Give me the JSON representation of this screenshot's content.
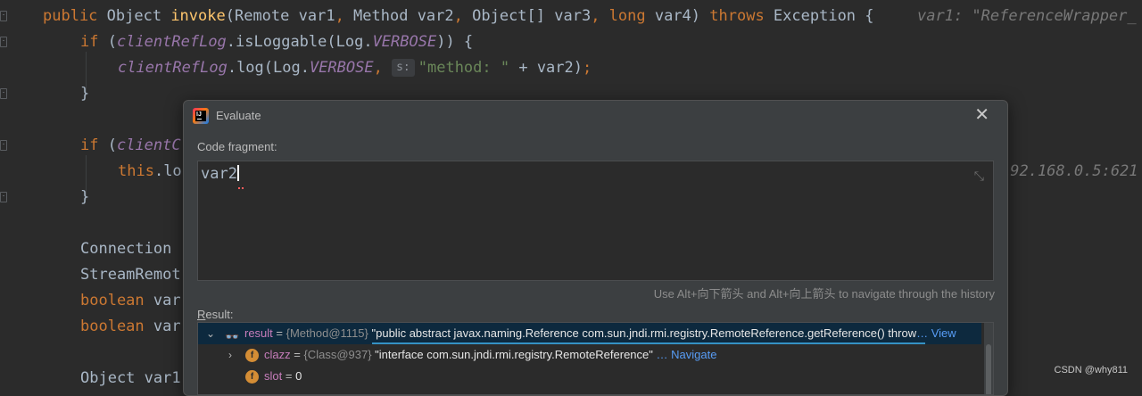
{
  "editor": {
    "lines": [
      {
        "parts": [
          [
            "kw",
            "public "
          ],
          [
            "plain",
            "Object "
          ],
          [
            "fn",
            "invoke"
          ],
          [
            "plain",
            "(Remote var1"
          ],
          [
            "kw",
            ", "
          ],
          [
            "plain",
            "Method var2"
          ],
          [
            "kw",
            ", "
          ],
          [
            "plain",
            "Object[] var3"
          ],
          [
            "kw",
            ", long "
          ],
          [
            "plain",
            "var4) "
          ],
          [
            "kw",
            "throws "
          ],
          [
            "plain",
            "Exception {"
          ]
        ]
      },
      {
        "parts": [
          [
            "kw",
            "if "
          ],
          [
            "plain",
            "("
          ],
          [
            "fld",
            "clientRefLog"
          ],
          [
            "plain",
            ".isLoggable(Log."
          ],
          [
            "fld",
            "VERBOSE"
          ],
          [
            "plain",
            ")) {"
          ]
        ]
      },
      {
        "parts": [
          [
            "fld",
            "clientRefLog"
          ],
          [
            "plain",
            ".log(Log."
          ],
          [
            "fld",
            "VERBOSE"
          ],
          [
            "kw",
            ", "
          ],
          [
            "hint",
            "s:"
          ],
          [
            "str",
            "\"method: \""
          ],
          [
            "plain",
            " + var2)"
          ],
          [
            "kw",
            ";"
          ]
        ]
      },
      {
        "parts": [
          [
            "plain",
            "}"
          ]
        ]
      },
      {
        "parts": []
      },
      {
        "parts": [
          [
            "kw",
            "if "
          ],
          [
            "plain",
            "("
          ],
          [
            "fld",
            "clientC"
          ]
        ]
      },
      {
        "parts": [
          [
            "kw",
            "this"
          ],
          [
            "plain",
            ".lo"
          ]
        ]
      },
      {
        "parts": [
          [
            "plain",
            "}"
          ]
        ]
      },
      {
        "parts": []
      },
      {
        "parts": [
          [
            "plain",
            "Connection "
          ]
        ]
      },
      {
        "parts": [
          [
            "plain",
            "StreamRemot"
          ]
        ]
      },
      {
        "parts": [
          [
            "kw",
            "boolean "
          ],
          [
            "plain",
            "var"
          ]
        ]
      },
      {
        "parts": [
          [
            "kw",
            "boolean "
          ],
          [
            "plain",
            "var"
          ]
        ]
      },
      {
        "parts": []
      },
      {
        "parts": [
          [
            "plain",
            "Object var1"
          ]
        ]
      }
    ],
    "inline_value_1": "var1: \"ReferenceWrapper_",
    "inline_value_2": "192.168.0.5:621"
  },
  "dialog": {
    "title": "Evaluate",
    "close_glyph": "✕",
    "code_fragment_label": "Code fragment:",
    "code_value": "var2",
    "collapse_glyph": "⤡",
    "history_hint": "Use Alt+向下箭头 and Alt+向上箭头 to navigate through the history",
    "result_label_mnemonic": "R",
    "result_label_rest": "esult:",
    "result_rows": [
      {
        "chevron": "⌄",
        "icon": "eyes",
        "name": "result",
        "meta": "{Method@1115}",
        "value": "\"public abstract javax.naming.Reference com.sun.jndi.rmi.registry.RemoteReference.getReference() throw",
        "link": "View",
        "selected": true
      },
      {
        "chevron": "›",
        "icon": "f",
        "name": "clazz",
        "meta": "{Class@937}",
        "value": "\"interface com.sun.jndi.rmi.registry.RemoteReference\"",
        "link": "Navigate",
        "selected": false
      },
      {
        "chevron": "",
        "icon": "f",
        "name": "slot",
        "meta": "",
        "value": "0",
        "link": "",
        "selected": false
      }
    ]
  },
  "watermark": "CSDN @why811",
  "colors": {
    "background": "#2b2b2b",
    "keyword": "#cc7832",
    "field": "#9876aa",
    "string": "#6a8759",
    "selection": "#0d293e",
    "accent": "#3592c4"
  }
}
